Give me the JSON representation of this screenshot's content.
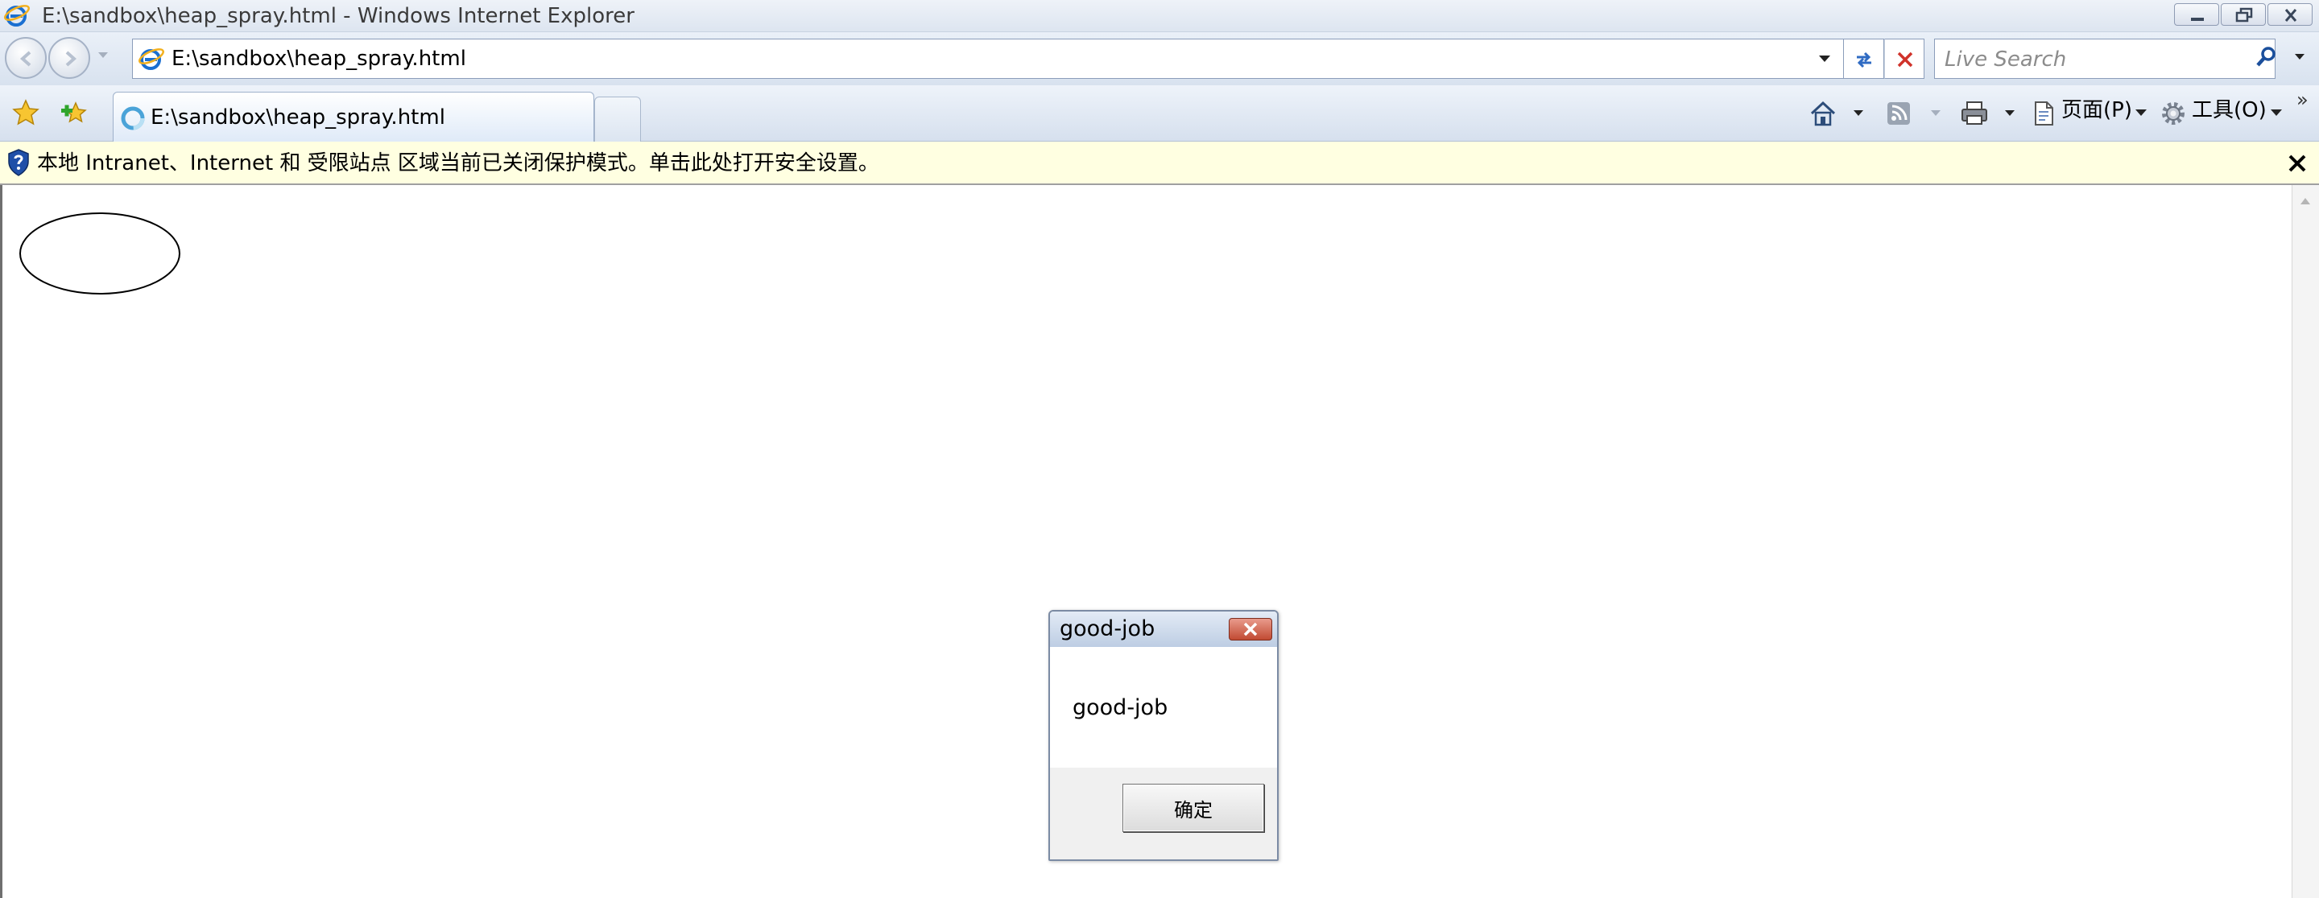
{
  "window": {
    "title": "E:\\sandbox\\heap_spray.html - Windows Internet Explorer",
    "controls": [
      "minimize",
      "maximize",
      "close"
    ]
  },
  "navbar": {
    "address": "E:\\sandbox\\heap_spray.html",
    "search_placeholder": "Live Search"
  },
  "tabs": [
    {
      "label": "E:\\sandbox\\heap_spray.html",
      "active": true
    }
  ],
  "command_bar": {
    "page_label": "页面(P)",
    "tools_label": "工具(O)",
    "overflow": "»"
  },
  "infobar": {
    "text": "本地 Intranet、Internet 和 受限站点 区域当前已关闭保护模式。单击此处打开安全设置。",
    "close": "✕"
  },
  "dialog": {
    "title": "good-job",
    "message": "good-job",
    "ok_label": "确定"
  },
  "colors": {
    "chrome_top": "#eef2f8",
    "infobar_bg": "#ffffe1",
    "dialog_close_red": "#c14a32"
  }
}
